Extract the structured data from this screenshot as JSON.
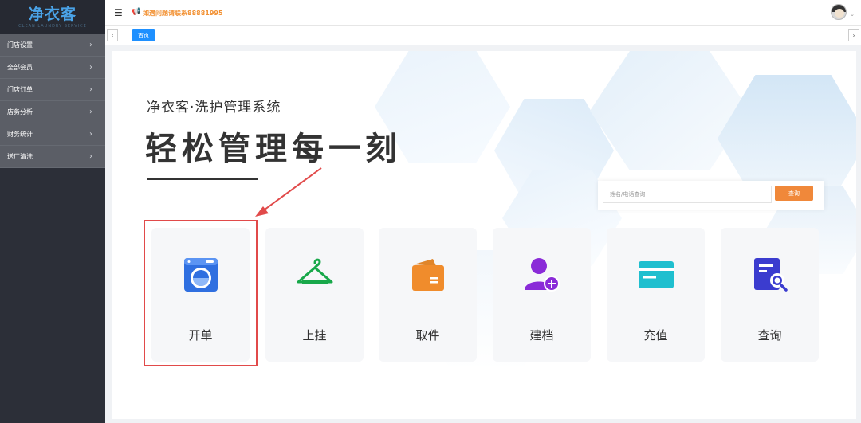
{
  "logo": {
    "text": "净衣客",
    "sub": "CLEAN LAUNDRY SERVICE"
  },
  "sidebar": {
    "items": [
      {
        "label": "门店设置"
      },
      {
        "label": "全部会员"
      },
      {
        "label": "门店订单"
      },
      {
        "label": "店务分析"
      },
      {
        "label": "财务统计"
      },
      {
        "label": "送厂清洗"
      }
    ]
  },
  "topbar": {
    "notice": "如遇问题请联系88881995"
  },
  "tabs": {
    "home": "首页"
  },
  "hero": {
    "subtitle": "净衣客·洗护管理系统",
    "title": "轻松管理每一刻"
  },
  "search": {
    "placeholder": "姓名/电话查询",
    "button": "查询"
  },
  "cards": [
    {
      "label": "开单",
      "icon": "washing-machine-icon"
    },
    {
      "label": "上挂",
      "icon": "hanger-icon"
    },
    {
      "label": "取件",
      "icon": "wallet-icon"
    },
    {
      "label": "建档",
      "icon": "add-user-icon"
    },
    {
      "label": "充值",
      "icon": "card-icon"
    },
    {
      "label": "查询",
      "icon": "search-document-icon"
    }
  ],
  "colors": {
    "accent": "#1e90ff",
    "highlight": "#e14a4a",
    "search_button": "#f0883a",
    "sidebar": "#5b5e66"
  }
}
